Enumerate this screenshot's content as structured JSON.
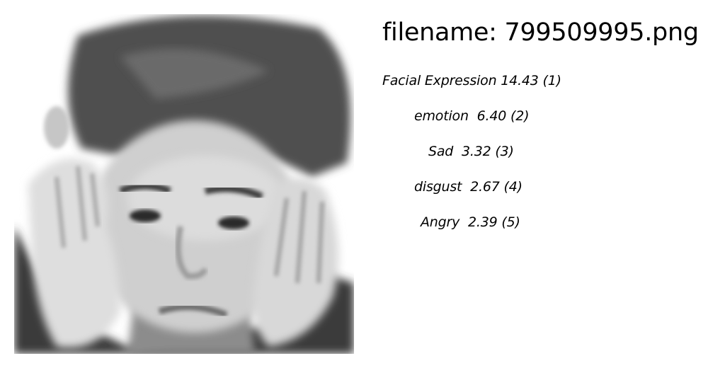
{
  "filename_prefix": "filename:",
  "filename": "799509995.png",
  "labels": [
    {
      "name": "Facial Expression",
      "score": "14.43",
      "rank": "(1)"
    },
    {
      "name": "emotion",
      "score": "6.40",
      "rank": "(2)"
    },
    {
      "name": "Sad",
      "score": "3.32",
      "rank": "(3)"
    },
    {
      "name": "disgust",
      "score": "2.67",
      "rank": "(4)"
    },
    {
      "name": "Angry",
      "score": "2.39",
      "rank": "(5)"
    }
  ]
}
